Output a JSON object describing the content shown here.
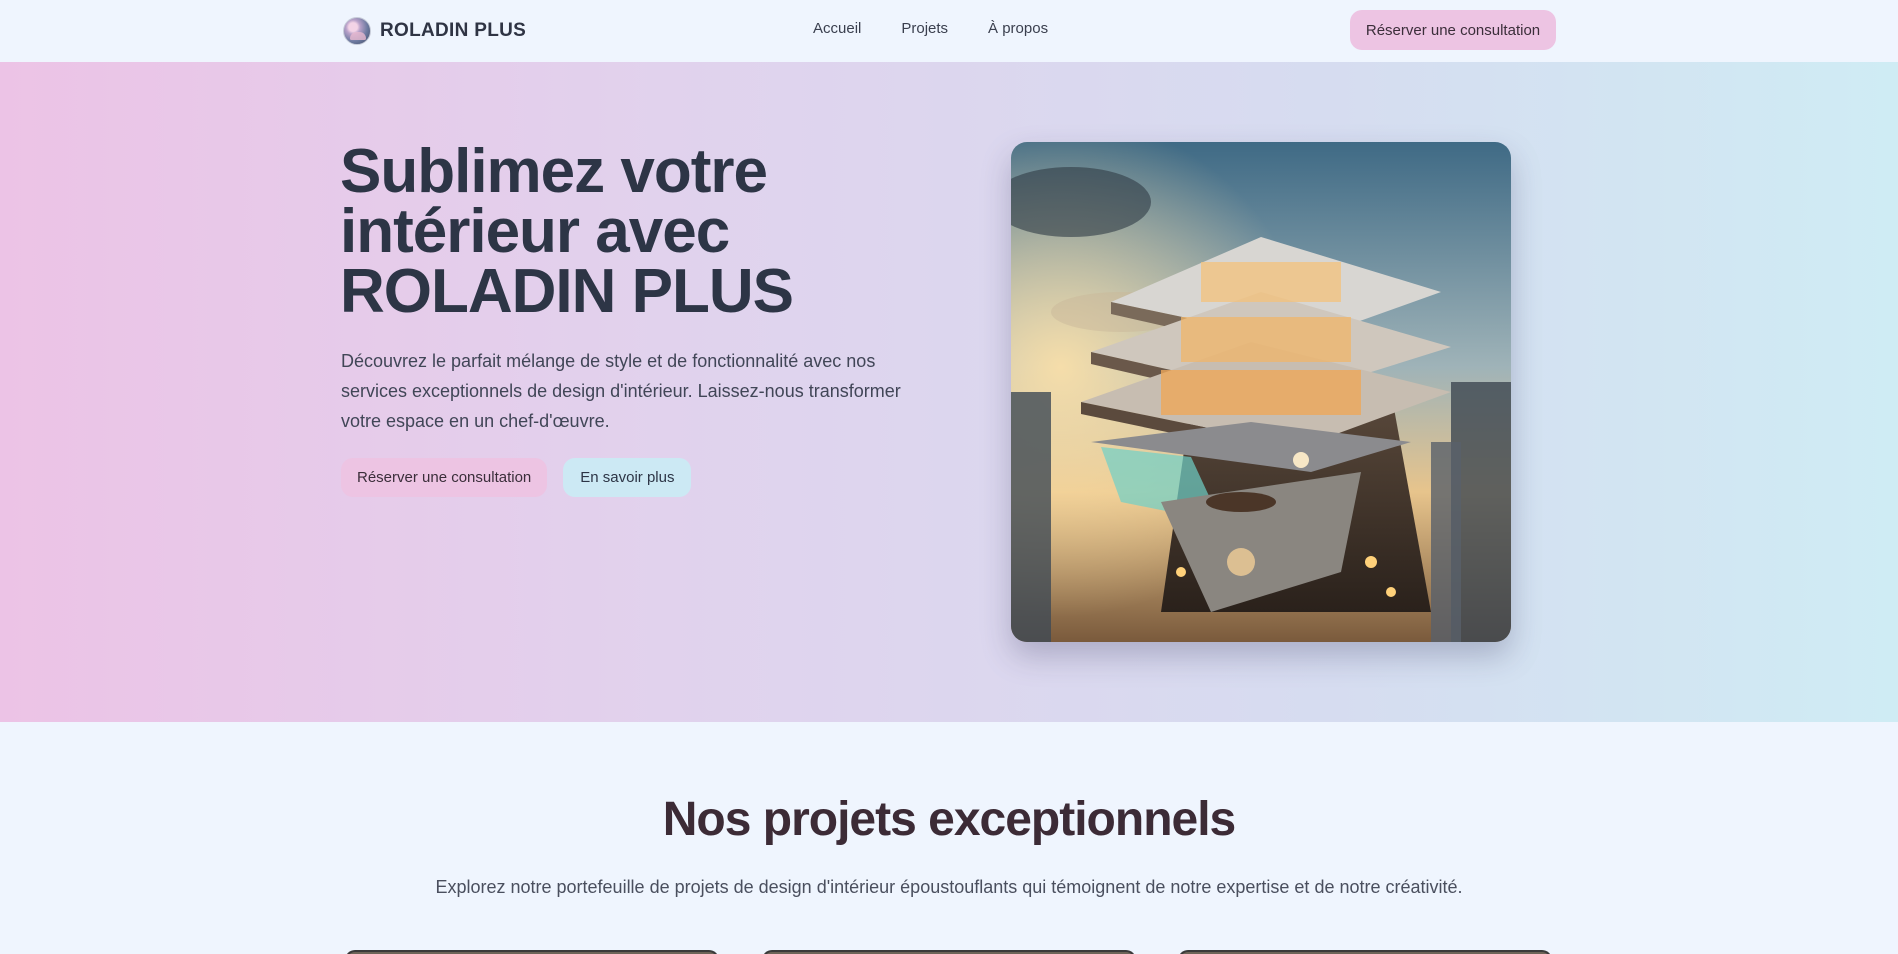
{
  "header": {
    "brand_name": "ROLADIN PLUS",
    "nav": [
      "Accueil",
      "Projets",
      "À propos"
    ],
    "cta_label": "Réserver une consultation"
  },
  "hero": {
    "title": "Sublimez votre intérieur avec ROLADIN PLUS",
    "text": "Découvrez le parfait mélange de style et de fonctionnalité avec nos services exceptionnels de design d'intérieur. Laissez-nous transformer votre espace en un chef-d'œuvre.",
    "primary_button": "Réserver une consultation",
    "secondary_button": "En savoir plus"
  },
  "projects": {
    "title": "Nos projets exceptionnels",
    "subtitle": "Explorez notre portefeuille de projets de design d'intérieur époustouflants qui témoignent de notre expertise et de notre créativité."
  },
  "colors": {
    "accent_pink": "#edc4e3",
    "accent_blue": "#cce9f4",
    "text_dark": "#2d3546",
    "page_bg": "#eff5fe"
  }
}
